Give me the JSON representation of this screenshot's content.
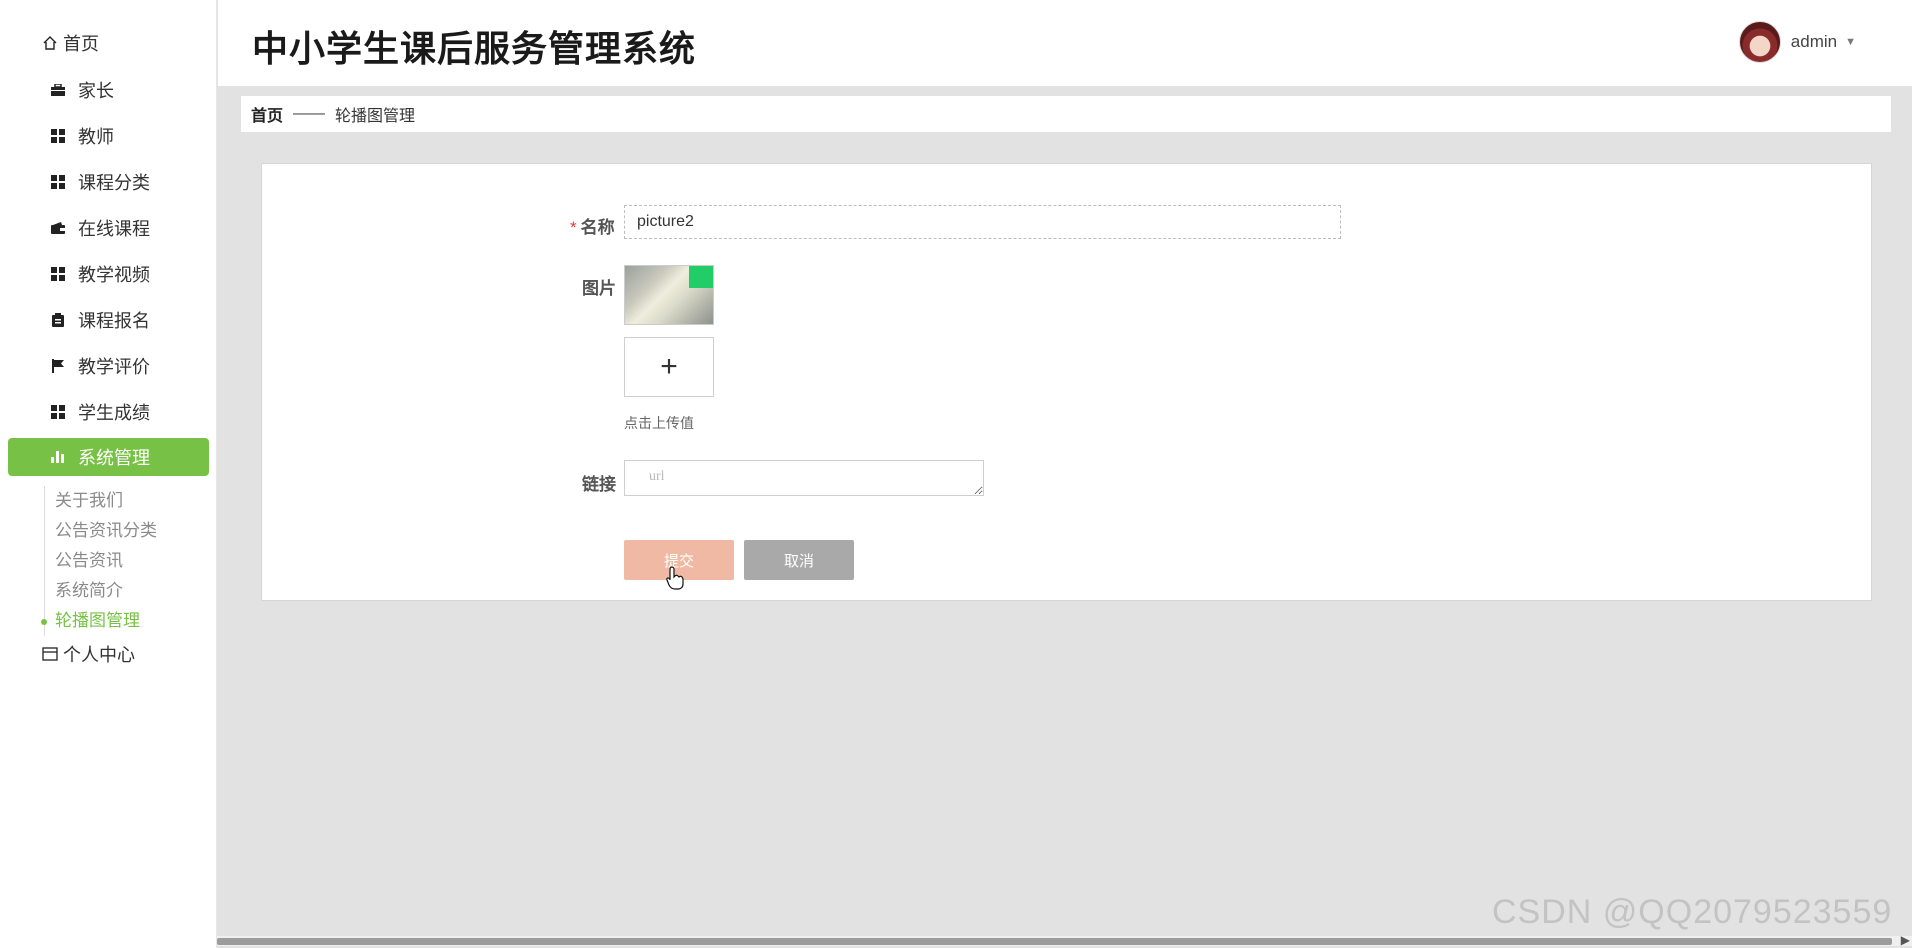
{
  "app": {
    "title": "中小学生课后服务管理系统"
  },
  "user": {
    "name": "admin"
  },
  "sidebar": {
    "items": [
      {
        "label": "首页",
        "icon": "home-icon"
      },
      {
        "label": "家长",
        "icon": "briefcase-icon"
      },
      {
        "label": "教师",
        "icon": "grid-icon"
      },
      {
        "label": "课程分类",
        "icon": "grid-icon"
      },
      {
        "label": "在线课程",
        "icon": "wallet-icon"
      },
      {
        "label": "教学视频",
        "icon": "grid-icon"
      },
      {
        "label": "课程报名",
        "icon": "clipboard-icon"
      },
      {
        "label": "教学评价",
        "icon": "flag-icon"
      },
      {
        "label": "学生成绩",
        "icon": "grid-icon"
      },
      {
        "label": "系统管理",
        "icon": "bar-chart-icon"
      }
    ],
    "submenu": [
      "关于我们",
      "公告资讯分类",
      "公告资讯",
      "系统简介",
      "轮播图管理"
    ],
    "last": {
      "label": "个人中心",
      "icon": "card-icon"
    },
    "active_color": "#77c246"
  },
  "breadcrumb": {
    "home": "首页",
    "separator": "——",
    "current": "轮播图管理"
  },
  "form": {
    "name_label": "名称",
    "name_value": "picture2",
    "image_label": "图片",
    "upload_tip": "点击上传值",
    "link_label": "链接",
    "link_placeholder": "url",
    "submit_label": "提交",
    "cancel_label": "取消"
  },
  "watermark": "CSDN @QQ2079523559"
}
